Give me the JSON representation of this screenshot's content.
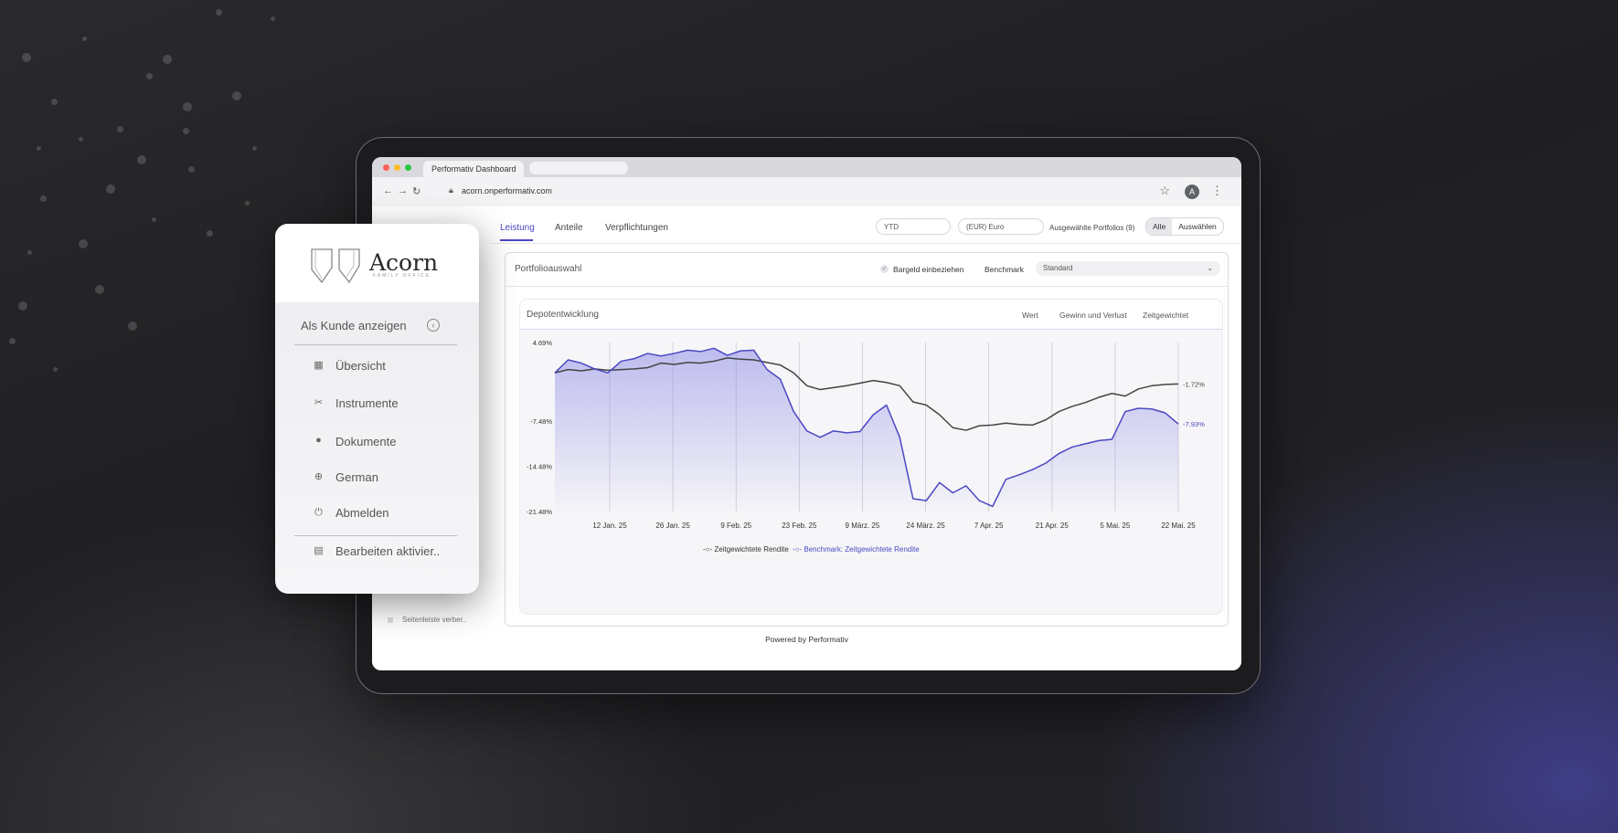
{
  "browser": {
    "tab_title": "Performativ Dashboard",
    "url": "acorn.onperformativ.com",
    "avatar_letter": "A"
  },
  "app": {
    "tabs": [
      "Leistung",
      "Anteile",
      "Verpflichtungen"
    ],
    "active_tab": "Leistung",
    "period_value": "YTD",
    "currency_value": "(EUR) Euro",
    "portfolios_label": "Ausgewählte Portfolios (9)",
    "segment": [
      "Alle",
      "Auswählen"
    ],
    "panel_title": "Portfolioauswahl",
    "cash_label": "Bargeld einbeziehen",
    "benchmark_label": "Benchmark",
    "benchmark_value": "Standard",
    "chart_card_title": "Depotentwicklung",
    "chart_options": [
      "Wert",
      "Gewinn und Verlust",
      "Zeitgewichtet"
    ],
    "sidebar_stub": "Seitenleiste verber..",
    "powered_by": "Powered by Performativ"
  },
  "sidebar": {
    "brand": "Acorn",
    "brand_sub": "FAMILY OFFICE",
    "as_client": "Als Kunde anzeigen",
    "items": [
      {
        "label": "Übersicht",
        "icon": "dashboard-icon"
      },
      {
        "label": "Instrumente",
        "icon": "tools-icon"
      },
      {
        "label": "Dokumente",
        "icon": "document-icon"
      },
      {
        "label": "German",
        "icon": "globe-icon"
      },
      {
        "label": "Abmelden",
        "icon": "power-icon"
      }
    ],
    "edit_item": {
      "label": "Bearbeiten aktivier..",
      "icon": "layout-icon"
    }
  },
  "colors": {
    "accent": "#4b48c2",
    "portfolio_line": "#444444",
    "benchmark_line": "#4b48c2"
  },
  "chart_data": {
    "type": "line",
    "title": "Depotentwicklung",
    "x_ticks": [
      "12 Jan. 25",
      "26 Jan. 25",
      "9 Feb. 25",
      "23 Feb. 25",
      "9 März. 25",
      "24 März. 25",
      "7 Apr. 25",
      "21 Apr. 25",
      "5 Mai. 25",
      "22 Mai. 25"
    ],
    "y_ticks": [
      "4.69%",
      "-7.48%",
      "-14.48%",
      "-21.48%"
    ],
    "ylim": [
      -21.48,
      4.69
    ],
    "grid": "vertical",
    "legend_position": "bottom",
    "series": [
      {
        "name": "Zeitgewichtete Rendite",
        "color": "#444444",
        "end_label": "-1.72%",
        "values": [
          0.0,
          0.5,
          0.3,
          0.6,
          0.4,
          0.5,
          0.6,
          0.8,
          1.5,
          1.3,
          1.6,
          1.5,
          1.8,
          2.3,
          2.1,
          2.0,
          1.6,
          1.2,
          0.0,
          -2.0,
          -2.6,
          -2.3,
          -2.0,
          -1.6,
          -1.2,
          -1.5,
          -2.0,
          -4.5,
          -5.0,
          -6.5,
          -8.5,
          -8.9,
          -8.2,
          -8.1,
          -7.8,
          -8.0,
          -8.1,
          -7.3,
          -6.0,
          -5.2,
          -4.6,
          -3.8,
          -3.2,
          -3.6,
          -2.5,
          -2.0,
          -1.8,
          -1.72
        ]
      },
      {
        "name": "Benchmark: Zeitgewichtete Rendite",
        "color": "#4b48c2",
        "end_label": "-7.93%",
        "values": [
          0.0,
          2.0,
          1.5,
          0.6,
          0.0,
          1.8,
          2.2,
          3.0,
          2.6,
          3.0,
          3.5,
          3.3,
          3.8,
          2.7,
          3.4,
          3.5,
          0.5,
          -1.0,
          -6.0,
          -9.0,
          -10.0,
          -9.0,
          -9.3,
          -9.1,
          -6.5,
          -5.0,
          -10.0,
          -19.5,
          -19.8,
          -17.0,
          -18.6,
          -17.5,
          -19.8,
          -20.7,
          -16.5,
          -15.8,
          -15.0,
          -14.0,
          -12.5,
          -11.5,
          -11.0,
          -10.5,
          -10.3,
          -6.0,
          -5.5,
          -5.6,
          -6.2,
          -7.93
        ]
      }
    ]
  }
}
